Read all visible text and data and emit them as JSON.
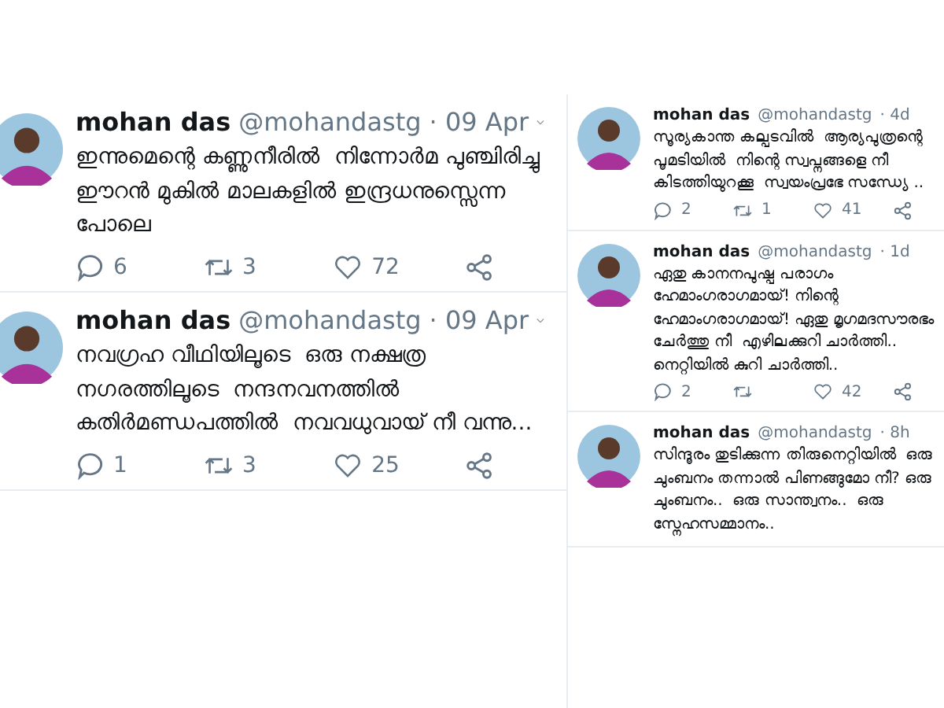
{
  "columns": [
    {
      "kind": "large",
      "tweets": [
        {
          "name": "mohan das",
          "handle": "@mohandastg",
          "time": "· 09 Apr",
          "text": "ഇന്നുമെന്റെ കണ്ണുനീരിൽ  നിന്നോർമ പുഞ്ചിരിച്ചു  ഈറൻ മുകിൽ മാലകളിൽ ഇന്ദ്രധനുസ്സെന്ന പോലെ",
          "replies": "6",
          "retweets": "3",
          "likes": "72"
        },
        {
          "name": "mohan das",
          "handle": "@mohandastg",
          "time": "· 09 Apr",
          "text": "നവഗ്രഹ വീഥിയിലൂടെ  ഒരു നക്ഷത്ര നഗരത്തിലൂടെ  നന്ദനവനത്തിൽ കതിർമണ്ഡപത്തിൽ  നവവധുവായ് നീ വന്നു...",
          "replies": "1",
          "retweets": "3",
          "likes": "25"
        }
      ]
    },
    {
      "kind": "small",
      "tweets": [
        {
          "name": "mohan das",
          "handle": "@mohandastg",
          "time": "· 4d",
          "text": "സൂര്യകാന്ത കല്പടവിൽ  ആര്യപുത്രന്റെ പൂമടിയിൽ  നിന്റെ സ്വപ്നങ്ങളെ നീ കിടത്തിയുറക്കൂ  സ്വയംപ്രഭേ സന്ധ്യേ ..",
          "replies": "2",
          "retweets": "1",
          "likes": "41"
        },
        {
          "name": "mohan das",
          "handle": "@mohandastg",
          "time": "· 1d",
          "text": "ഏതു കാനനപുഷ്പ പരാഗം ഹേമാംഗരാഗമായ്! നിന്റെ ഹേമാംഗരാഗമായ്! ഏതു മൃഗമദസൗരഭം ചേർത്തു നീ  എഴിലക്കുറി ചാർത്തി.. നെറ്റിയിൽ കുറി ചാർത്തി..",
          "replies": "2",
          "likes": "42"
        },
        {
          "name": "mohan das",
          "handle": "@mohandastg",
          "time": "· 8h",
          "text": "സിന്ദൂരം തുടിക്കുന്ന തിരുനെറ്റിയിൽ  ഒരു ചുംബനം തന്നാൽ പിണങ്ങുമോ നീ? ഒരു ചുംബനം..  ഒരു സാന്ത്വനം..  ഒരു സ്നേഹസമ്മാനം.."
        }
      ]
    }
  ]
}
